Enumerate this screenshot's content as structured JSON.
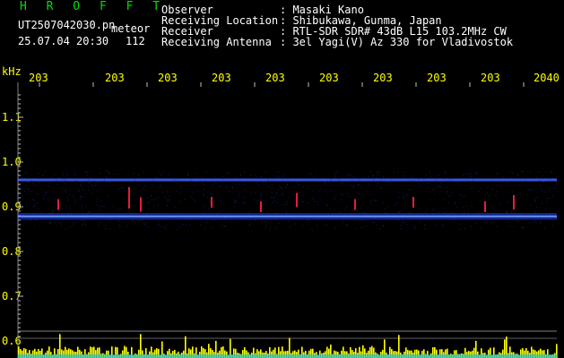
{
  "app": {
    "title": "H R O F F T",
    "filename": "UT2507042030.pn",
    "mode": "meteor",
    "datetime": "25.07.04 20:30",
    "count": "112"
  },
  "header": {
    "labels": [
      "Observer",
      "Receiving Location",
      "Receiver",
      "Receiving Antenna"
    ],
    "values": [
      ": Masaki Kano",
      ": Shibukawa, Gunma, Japan",
      ": RTL-SDR SDR# 43dB L15 103.2MHz CW",
      ": 3el Yagi(V) Az 330 for Vladivostok"
    ]
  },
  "axis": {
    "unit": "kHz",
    "y_ticks": [
      "1.1",
      "1.0",
      "0.9",
      "0.8",
      "0.7",
      "0.6"
    ],
    "x_ticks": [
      "203",
      "203",
      "203",
      "203",
      "203",
      "203",
      "203",
      "203",
      "203",
      "2040"
    ]
  },
  "colors": {
    "label": "#ffffff",
    "time": "#ffff00",
    "title": "#00e000",
    "signal": "#2040ff",
    "reference": "#4060ff",
    "meteor": "#ff2040",
    "histogram": "#ffff00",
    "histogram_base": "#00c0ff"
  },
  "chart_data": {
    "type": "heatmap",
    "ylabel": "kHz",
    "ylim": [
      0.6,
      1.15
    ],
    "yticks": [
      1.1,
      1.0,
      0.9,
      0.8,
      0.7,
      0.6
    ],
    "reference_line_khz": 0.96,
    "carrier_band_khz": [
      0.871,
      0.886
    ],
    "grid": false
  }
}
